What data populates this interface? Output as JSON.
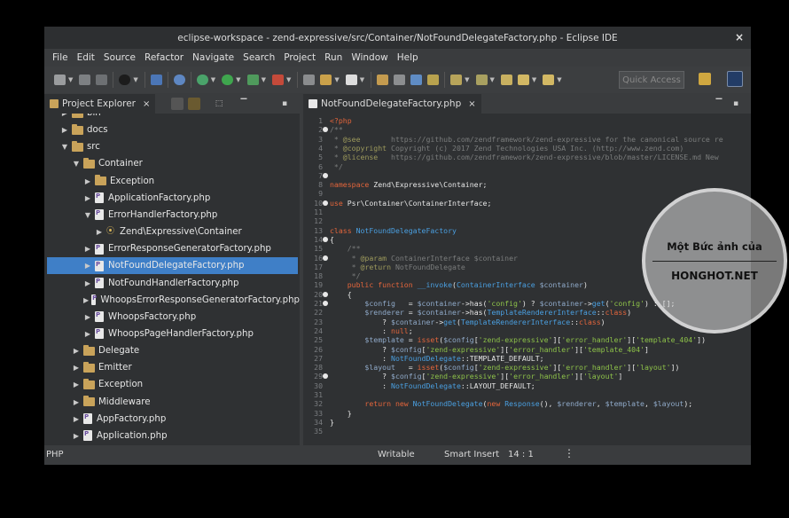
{
  "window": {
    "title": "eclipse-workspace - zend-expressive/src/Container/NotFoundDelegateFactory.php - Eclipse IDE",
    "close": "×"
  },
  "menu": [
    "File",
    "Edit",
    "Source",
    "Refactor",
    "Navigate",
    "Search",
    "Project",
    "Run",
    "Window",
    "Help"
  ],
  "toolbar": {
    "quick_access": "Quick Access"
  },
  "project_explorer": {
    "tab_label": "Project Explorer",
    "tab_close": "×",
    "items": [
      {
        "label": "bin",
        "level": 1,
        "type": "folder",
        "expanded": false
      },
      {
        "label": "docs",
        "level": 1,
        "type": "folder",
        "expanded": false
      },
      {
        "label": "src",
        "level": 1,
        "type": "pfolder",
        "expanded": true
      },
      {
        "label": "Container",
        "level": 2,
        "type": "folder",
        "expanded": true
      },
      {
        "label": "Exception",
        "level": 3,
        "type": "folder",
        "expanded": false
      },
      {
        "label": "ApplicationFactory.php",
        "level": 3,
        "type": "file",
        "expanded": false
      },
      {
        "label": "ErrorHandlerFactory.php",
        "level": 3,
        "type": "file",
        "expanded": true
      },
      {
        "label": "Zend\\Expressive\\Container",
        "level": 4,
        "type": "ns",
        "expanded": false
      },
      {
        "label": "ErrorResponseGeneratorFactory.php",
        "level": 3,
        "type": "file",
        "expanded": false
      },
      {
        "label": "NotFoundDelegateFactory.php",
        "level": 3,
        "type": "file",
        "expanded": false,
        "selected": true
      },
      {
        "label": "NotFoundHandlerFactory.php",
        "level": 3,
        "type": "file",
        "expanded": false
      },
      {
        "label": "WhoopsErrorResponseGeneratorFactory.php",
        "level": 3,
        "type": "file",
        "expanded": false
      },
      {
        "label": "WhoopsFactory.php",
        "level": 3,
        "type": "file",
        "expanded": false
      },
      {
        "label": "WhoopsPageHandlerFactory.php",
        "level": 3,
        "type": "file",
        "expanded": false
      },
      {
        "label": "Delegate",
        "level": 2,
        "type": "folder",
        "expanded": false
      },
      {
        "label": "Emitter",
        "level": 2,
        "type": "folder",
        "expanded": false
      },
      {
        "label": "Exception",
        "level": 2,
        "type": "folder",
        "expanded": false
      },
      {
        "label": "Middleware",
        "level": 2,
        "type": "pfolder",
        "expanded": false
      },
      {
        "label": "AppFactory.php",
        "level": 2,
        "type": "file",
        "expanded": false
      },
      {
        "label": "Application.php",
        "level": 2,
        "type": "file",
        "expanded": false
      }
    ]
  },
  "editor": {
    "tab_label": "NotFoundDelegateFactory.php",
    "tab_close": "×",
    "lines": [
      [
        [
          "<?php",
          "k"
        ]
      ],
      [
        [
          "/**",
          "c"
        ]
      ],
      [
        [
          " * ",
          "c"
        ],
        [
          "@see",
          "ca"
        ],
        [
          "       https://github.com/zendframework/zend-expressive for the canonical source re",
          "c"
        ]
      ],
      [
        [
          " * ",
          "c"
        ],
        [
          "@copyright",
          "ca"
        ],
        [
          " Copyright (c) 2017 Zend Technologies USA Inc. (http://www.zend.com)",
          "c"
        ]
      ],
      [
        [
          " * ",
          "c"
        ],
        [
          "@license",
          "ca"
        ],
        [
          "   https://github.com/zendframework/zend-expressive/blob/master/LICENSE.md New",
          "c"
        ]
      ],
      [
        [
          " */",
          "c"
        ]
      ],
      [],
      [
        [
          "namespace ",
          "k"
        ],
        [
          "Zend\\Expressive\\Container;",
          "f"
        ]
      ],
      [],
      [
        [
          "use ",
          "k"
        ],
        [
          "Psr\\Container\\ContainerInterface;",
          "f"
        ]
      ],
      [],
      [],
      [
        [
          "class ",
          "k"
        ],
        [
          "NotFoundDelegateFactory",
          "t"
        ]
      ],
      [
        [
          "{",
          "f"
        ]
      ],
      [
        [
          "    /**",
          "c"
        ]
      ],
      [
        [
          "     * ",
          "c"
        ],
        [
          "@param",
          "ca"
        ],
        [
          " ContainerInterface $container",
          "c"
        ]
      ],
      [
        [
          "     * ",
          "c"
        ],
        [
          "@return",
          "ca"
        ],
        [
          " NotFoundDelegate",
          "c"
        ]
      ],
      [
        [
          "     */",
          "c"
        ]
      ],
      [
        [
          "    public function ",
          "k"
        ],
        [
          "__invoke",
          "t"
        ],
        [
          "(",
          "f"
        ],
        [
          "ContainerInterface",
          "t"
        ],
        [
          " $container",
          "v"
        ],
        [
          ")",
          "f"
        ]
      ],
      [
        [
          "    {",
          "f"
        ]
      ],
      [
        [
          "        $config",
          "v"
        ],
        [
          "   = ",
          "f"
        ],
        [
          "$container",
          "v"
        ],
        [
          "->has(",
          "f"
        ],
        [
          "'config'",
          "s"
        ],
        [
          ") ? ",
          "f"
        ],
        [
          "$container",
          "v"
        ],
        [
          "->",
          "f"
        ],
        [
          "get",
          "t"
        ],
        [
          "(",
          "f"
        ],
        [
          "'config'",
          "s"
        ],
        [
          ") : [];",
          "f"
        ]
      ],
      [
        [
          "        $renderer",
          "v"
        ],
        [
          " = ",
          "f"
        ],
        [
          "$container",
          "v"
        ],
        [
          "->has(",
          "f"
        ],
        [
          "TemplateRendererInterface",
          "t"
        ],
        [
          "::",
          "f"
        ],
        [
          "class",
          "k"
        ],
        [
          ")",
          "f"
        ]
      ],
      [
        [
          "            ? ",
          "f"
        ],
        [
          "$container",
          "v"
        ],
        [
          "->",
          "f"
        ],
        [
          "get",
          "t"
        ],
        [
          "(",
          "f"
        ],
        [
          "TemplateRendererInterface",
          "t"
        ],
        [
          "::",
          "f"
        ],
        [
          "class",
          "k"
        ],
        [
          ")",
          "f"
        ]
      ],
      [
        [
          "            : ",
          "f"
        ],
        [
          "null",
          "k"
        ],
        [
          ";",
          "f"
        ]
      ],
      [
        [
          "        $template",
          "v"
        ],
        [
          " = ",
          "f"
        ],
        [
          "isset",
          "k"
        ],
        [
          "(",
          "f"
        ],
        [
          "$config",
          "v"
        ],
        [
          "[",
          "f"
        ],
        [
          "'zend-expressive'",
          "s"
        ],
        [
          "][",
          "f"
        ],
        [
          "'error_handler'",
          "s"
        ],
        [
          "][",
          "f"
        ],
        [
          "'template_404'",
          "s"
        ],
        [
          "])",
          "f"
        ]
      ],
      [
        [
          "            ? ",
          "f"
        ],
        [
          "$config",
          "v"
        ],
        [
          "[",
          "f"
        ],
        [
          "'zend-expressive'",
          "s"
        ],
        [
          "][",
          "f"
        ],
        [
          "'error_handler'",
          "s"
        ],
        [
          "][",
          "f"
        ],
        [
          "'template_404'",
          "s"
        ],
        [
          "]",
          "f"
        ]
      ],
      [
        [
          "            : ",
          "f"
        ],
        [
          "NotFoundDelegate",
          "t"
        ],
        [
          "::TEMPLATE_DEFAULT;",
          "f"
        ]
      ],
      [
        [
          "        $layout",
          "v"
        ],
        [
          "   = ",
          "f"
        ],
        [
          "isset",
          "k"
        ],
        [
          "(",
          "f"
        ],
        [
          "$config",
          "v"
        ],
        [
          "[",
          "f"
        ],
        [
          "'zend-expressive'",
          "s"
        ],
        [
          "][",
          "f"
        ],
        [
          "'error_handler'",
          "s"
        ],
        [
          "][",
          "f"
        ],
        [
          "'layout'",
          "s"
        ],
        [
          "])",
          "f"
        ]
      ],
      [
        [
          "            ? ",
          "f"
        ],
        [
          "$config",
          "v"
        ],
        [
          "[",
          "f"
        ],
        [
          "'zend-expressive'",
          "s"
        ],
        [
          "][",
          "f"
        ],
        [
          "'error_handler'",
          "s"
        ],
        [
          "][",
          "f"
        ],
        [
          "'layout'",
          "s"
        ],
        [
          "]",
          "f"
        ]
      ],
      [
        [
          "            : ",
          "f"
        ],
        [
          "NotFoundDelegate",
          "t"
        ],
        [
          "::LAYOUT_DEFAULT;",
          "f"
        ]
      ],
      [],
      [
        [
          "        return new ",
          "k"
        ],
        [
          "NotFoundDelegate",
          "t"
        ],
        [
          "(",
          "f"
        ],
        [
          "new ",
          "k"
        ],
        [
          "Response",
          "t"
        ],
        [
          "(), ",
          "f"
        ],
        [
          "$renderer",
          "v"
        ],
        [
          ", ",
          "f"
        ],
        [
          "$template",
          "v"
        ],
        [
          ", ",
          "f"
        ],
        [
          "$layout",
          "v"
        ],
        [
          ");",
          "f"
        ]
      ],
      [
        [
          "    }",
          "f"
        ]
      ],
      [
        [
          "}",
          "f"
        ]
      ],
      []
    ]
  },
  "status": {
    "language": "PHP",
    "mode": "Writable",
    "insert": "Smart Insert",
    "position": "14 : 1"
  },
  "watermark": {
    "line1": "Một Bức ảnh của",
    "line2": "HONGHOT.NET"
  }
}
